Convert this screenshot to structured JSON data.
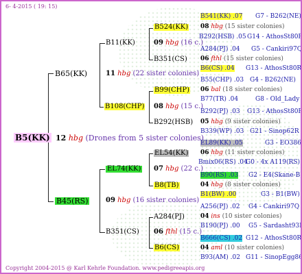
{
  "header": "6- 4-2015 ( 19: 15)",
  "footer": "Copyright 2004-2015 @ Karl Kehrle Foundation.   www.pedigreeapis.org",
  "root": {
    "label": "B5(KK)",
    "gen_num": "12",
    "hbg": "hbg",
    "note": "(Drones from 5 sister colonies)"
  },
  "b65": {
    "label": "B65(KK)",
    "gen_num": "11",
    "hbg": "hbg",
    "note": "(22 sister colonies)"
  },
  "b11": {
    "label": "B11(KK)",
    "gen_num": "09",
    "hbg": "hbg",
    "note": "(16 c.)"
  },
  "b108": {
    "label": "B108(CHP)",
    "gen_num": "08",
    "hbg": "hbg",
    "note": "(15 c.)"
  },
  "b45": {
    "label": "B45(RS)",
    "gen_num": "09",
    "hbg": "hbg",
    "note": "(16 sister colonies)"
  },
  "el74": {
    "label": "EL74(KK)",
    "gen_num": "07",
    "hbg": "hbg",
    "note": "(22 c.)"
  },
  "b351rs": {
    "label": "B351(CS)",
    "gen_num": "06",
    "hbg": "fthl",
    "note": "(15 c.)"
  },
  "gen2": [
    {
      "label": "B524(KK)"
    },
    {
      "label": "B351(CS)"
    },
    {
      "label": "B99(CHP)"
    },
    {
      "label": "B292(HSB)"
    },
    {
      "label": "EL54(KK)"
    },
    {
      "label": "B8(TB)"
    },
    {
      "label": "A284(PJ)"
    },
    {
      "label": "B6(CS)"
    }
  ],
  "mid": [
    {
      "num": "08",
      "sub": "hbg",
      "note": "(15 sister colonies)"
    },
    {
      "num": "06",
      "sub": "fthl",
      "note": "(15 sister colonies)"
    },
    {
      "num": "06",
      "sub": "bal",
      "note": "(18 sister colonies)"
    },
    {
      "num": "05",
      "sub": "hbg",
      "note": "(9 sister colonies)"
    },
    {
      "num": "06",
      "sub": "hbg",
      "note": "(11 sister colonies)"
    },
    {
      "num": "04",
      "sub": "hbg",
      "note": "(8 sister colonies)"
    },
    {
      "num": "04",
      "sub": "ins",
      "note": "(10 sister colonies)"
    },
    {
      "num": "04",
      "sub": "aml",
      "note": "(10 sister colonies)"
    }
  ],
  "right": [
    {
      "label": "B541(KK) .07",
      "right": "G7 - B262(NE)"
    },
    {
      "label": "B292(HSB) .05",
      "right": "G14 - AthosSt80R"
    },
    {
      "label": "A284(PJ) .04",
      "right": "G5 - Cankiri97Q"
    },
    {
      "label": "B6(CS) .04",
      "right": "G13 - AthosSt80R"
    },
    {
      "label": "B55(CHP) .03",
      "right": "G4 - B262(NE)"
    },
    {
      "label": "B77(TR) .04",
      "right": "G8 - Old_Lady"
    },
    {
      "label": "B292(PJ) .03",
      "right": "G13 - AthosSt80R"
    },
    {
      "label": "B339(WP) .03",
      "right": "G21 - Sinop62R"
    },
    {
      "label": "EL89(KK) .05",
      "right": "G3 - EO386"
    },
    {
      "label": "Bmix06(RS) .04",
      "right": "G0 - 4x A119(RS)"
    },
    {
      "label": "B90(RS) .03",
      "right": "G2 - E4(Skane-B)"
    },
    {
      "label": "B1(BW) .00",
      "right": "G3 - B1(BW)"
    },
    {
      "label": "A256(PJ) .02",
      "right": "G4 - Cankiri97Q"
    },
    {
      "label": "B190(PJ) .00",
      "right": "G5 - Sardasht93R"
    },
    {
      "label": "B666(CS) .02",
      "right": "G12 - AthosSt80R"
    },
    {
      "label": "B93(AM) .02",
      "right": "G11 - SinopEgg86R"
    }
  ]
}
